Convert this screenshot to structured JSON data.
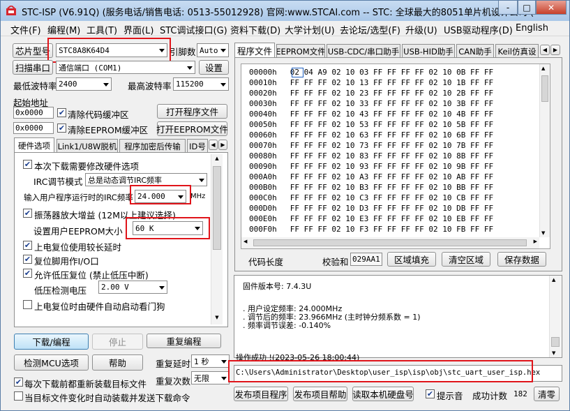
{
  "window": {
    "title": "STC-ISP (V6.91Q) (服务电话/销售电话: 0513-55012928) 官网:www.STCAI.com  -- STC: 全球最大的8051单片机设计公司 (",
    "controls": [
      "-",
      "□",
      "✕"
    ]
  },
  "menu": [
    "文件(F)",
    "编程(M)",
    "工具(T)",
    "界面(L)",
    "STC调试接口(G)",
    "资料下载(D)",
    "大学计划(U)",
    "去论坛/选型(F)",
    "升级(U)",
    "USB驱动程序(D)",
    "English"
  ],
  "left": {
    "chip_label": "芯片型号",
    "chip_value": "STC8A8K64D4",
    "pin_label": "引脚数",
    "pin_value": "Auto",
    "scan_label": "扫描串口",
    "port_value": "通信端口 (COM1)",
    "settings_label": "设置",
    "min_baud_label": "最低波特率",
    "min_baud_value": "2400",
    "max_baud_label": "最高波特率",
    "max_baud_value": "115200",
    "start_addr_label": "起始地址",
    "addr1": "0x0000",
    "addr2": "0x0000",
    "clear_code_label": "清除代码缓冲区",
    "clear_eeprom_label": "清除EEPROM缓冲区",
    "open_prog_label": "打开程序文件",
    "open_eeprom_label": "打开EEPROM文件",
    "tabs": [
      "硬件选项",
      "Link1/U8W脱机",
      "程序加密后传输",
      "ID号"
    ],
    "opts": {
      "modify_hw": "本次下载需要修改硬件选项",
      "irc_mode_label": "IRC调节模式",
      "irc_mode_value": "总是动态调节IRC频率",
      "freq_label": "输入用户程序运行时的IRC频率",
      "freq_value": "24.000",
      "freq_unit": "MHz",
      "osc_gain": "振荡器放大增益 (12M以上建议选择)",
      "eeprom_label": "设置用户EEPROM大小",
      "eeprom_value": "60    K",
      "long_delay": "上电复位使用较长延时",
      "reset_io": "复位脚用作I/O口",
      "lvd_reset": "允许低压复位 (禁止低压中断)",
      "lvd_label": "低压检测电压",
      "lvd_value": "2.00 V",
      "wdt": "上电复位时由硬件自动启动看门狗"
    },
    "download_label": "下载/编程",
    "stop_label": "停止",
    "reprogram_label": "重复编程",
    "detect_label": "检测MCU选项",
    "help_label": "帮助",
    "retry_delay_label": "重复延时",
    "retry_delay_value": "1 秒",
    "retry_count_label": "重复次数",
    "retry_count_value": "无限",
    "reload_label": "每次下载前都重新装载目标文件",
    "auto_send_label": "当目标文件变化时自动装载并发送下载命令"
  },
  "right": {
    "tabs": [
      "程序文件",
      "EEPROM文件",
      "USB-CDC/串口助手",
      "USB-HID助手",
      "CAN助手",
      "Keil仿真设"
    ],
    "hex_rows": [
      {
        "addr": "00000h",
        "bytes": "02 04 A9 02 10 03 FF FF FF FF 02 10 0B FF FF"
      },
      {
        "addr": "00010h",
        "bytes": "FF FF FF 02 10 13 FF FF FF FF 02 10 1B FF FF"
      },
      {
        "addr": "00020h",
        "bytes": "FF FF FF 02 10 23 FF FF FF FF 02 10 2B FF FF"
      },
      {
        "addr": "00030h",
        "bytes": "FF FF FF 02 10 33 FF FF FF FF 02 10 3B FF FF"
      },
      {
        "addr": "00040h",
        "bytes": "FF FF FF 02 10 43 FF FF FF FF 02 10 4B FF FF"
      },
      {
        "addr": "00050h",
        "bytes": "FF FF FF 02 10 53 FF FF FF FF 02 10 5B FF FF"
      },
      {
        "addr": "00060h",
        "bytes": "FF FF FF 02 10 63 FF FF FF FF 02 10 6B FF FF"
      },
      {
        "addr": "00070h",
        "bytes": "FF FF FF 02 10 73 FF FF FF FF 02 10 7B FF FF"
      },
      {
        "addr": "00080h",
        "bytes": "FF FF FF 02 10 83 FF FF FF FF 02 10 8B FF FF"
      },
      {
        "addr": "00090h",
        "bytes": "FF FF FF 02 10 93 FF FF FF FF 02 10 9B FF FF"
      },
      {
        "addr": "000A0h",
        "bytes": "FF FF FF 02 10 A3 FF FF FF FF 02 10 AB FF FF"
      },
      {
        "addr": "000B0h",
        "bytes": "FF FF FF 02 10 B3 FF FF FF FF 02 10 BB FF FF"
      },
      {
        "addr": "000C0h",
        "bytes": "FF FF FF 02 10 C3 FF FF FF FF 02 10 CB FF FF"
      },
      {
        "addr": "000D0h",
        "bytes": "FF FF FF 02 10 D3 FF FF FF FF 02 10 DB FF FF"
      },
      {
        "addr": "000E0h",
        "bytes": "FF FF FF 02 10 E3 FF FF FF FF 02 10 EB FF FF"
      },
      {
        "addr": "000F0h",
        "bytes": "FF FF FF 02 10 F3 FF FF FF FF 02 10 FB FF FF"
      }
    ],
    "code_len_label": "代码长度",
    "checksum_label": "校验和",
    "checksum_value": "029AA1",
    "fill_label": "区域填充",
    "clear_label": "清空区域",
    "save_label": "保存数据",
    "log": [
      "固件版本号: 7.4.3U",
      "",
      ". 用户设定频率: 24.000MHz",
      ". 调节后的频率: 23.966MHz (主时钟分频系数 = 1)",
      ". 频率调节误差: -0.140%",
      "",
      "",
      "操作成功 !(2023-05-26 18:00:44)"
    ],
    "file_path": "C:\\Users\\Administrator\\Desktop\\user_isp\\isp\\obj\\stc_uart_user_isp.hex",
    "publish_label": "发布项目程序",
    "publish_help_label": "发布项目帮助",
    "read_disk_label": "读取本机硬盘号",
    "sound_label": "提示音",
    "success_label": "成功计数",
    "success_count": "182",
    "clear_count_label": "清零"
  }
}
